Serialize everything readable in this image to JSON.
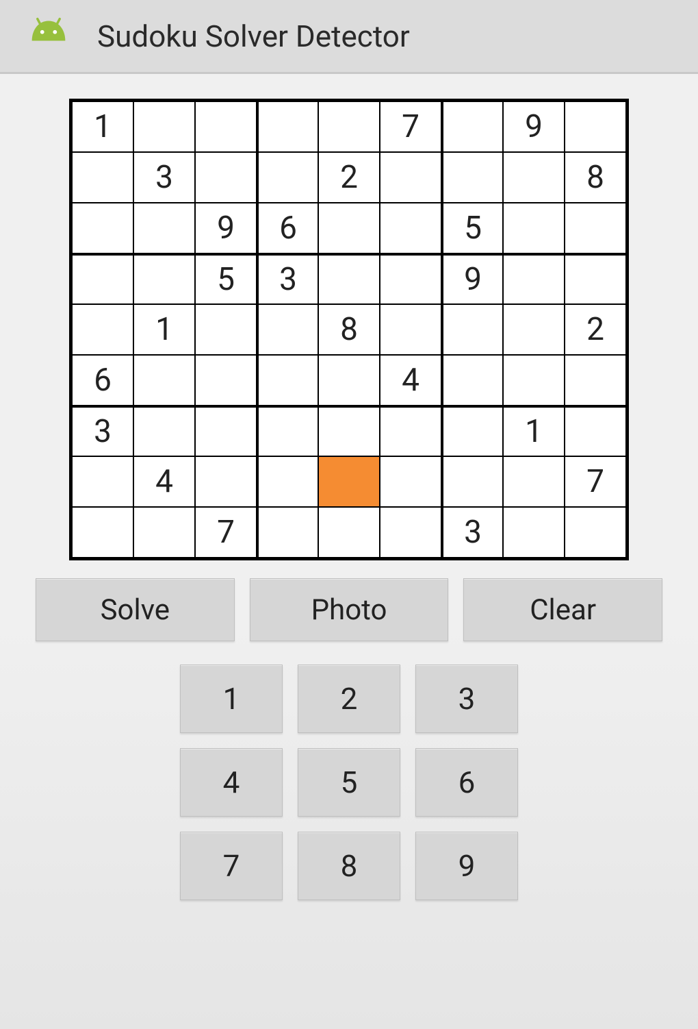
{
  "header": {
    "title": "Sudoku Solver Detector"
  },
  "colors": {
    "selected_cell": "#f58c32",
    "button_bg": "#d6d6d6",
    "header_bg": "#dcdcdc"
  },
  "grid": {
    "selected": {
      "row": 7,
      "col": 4
    },
    "rows": [
      [
        "1",
        "",
        "",
        "",
        "",
        "7",
        "",
        "9",
        ""
      ],
      [
        "",
        "3",
        "",
        "",
        "2",
        "",
        "",
        "",
        "8"
      ],
      [
        "",
        "",
        "9",
        "6",
        "",
        "",
        "5",
        "",
        ""
      ],
      [
        "",
        "",
        "5",
        "3",
        "",
        "",
        "9",
        "",
        ""
      ],
      [
        "",
        "1",
        "",
        "",
        "8",
        "",
        "",
        "",
        "2"
      ],
      [
        "6",
        "",
        "",
        "",
        "",
        "4",
        "",
        "",
        ""
      ],
      [
        "3",
        "",
        "",
        "",
        "",
        "",
        "",
        "1",
        ""
      ],
      [
        "",
        "4",
        "",
        "",
        "",
        "",
        "",
        "",
        "7"
      ],
      [
        "",
        "",
        "7",
        "",
        "",
        "",
        "3",
        "",
        ""
      ]
    ]
  },
  "actions": {
    "solve_label": "Solve",
    "photo_label": "Photo",
    "clear_label": "Clear"
  },
  "numpad": {
    "keys": [
      "1",
      "2",
      "3",
      "4",
      "5",
      "6",
      "7",
      "8",
      "9"
    ]
  }
}
